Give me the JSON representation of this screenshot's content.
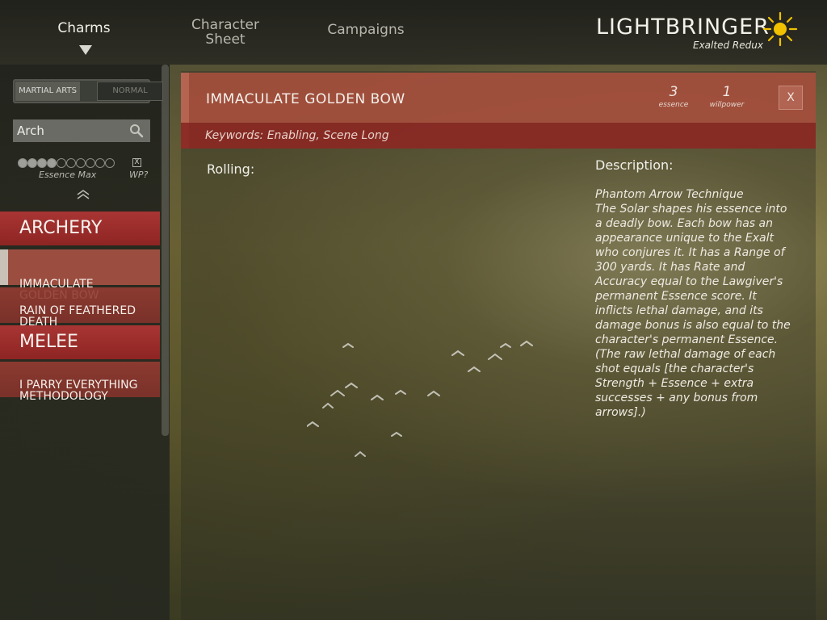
{
  "nav": {
    "tabs": [
      {
        "label": "Charms"
      },
      {
        "label": "Character\nSheet"
      },
      {
        "label": "Campaigns"
      }
    ],
    "active_tab": "Charms"
  },
  "brand": {
    "title": "LIGHTBRINGER",
    "subtitle": "Exalted Redux",
    "icon": "sun-icon",
    "accent": "#f2c200"
  },
  "sidebar": {
    "filter_toggle": {
      "options": [
        "MARTIAL ARTS",
        "NORMAL"
      ],
      "selected": "MARTIAL ARTS"
    },
    "search": {
      "value": "Arch",
      "placeholder": ""
    },
    "essence_max": {
      "label": "Essence Max",
      "filled": 4,
      "total": 10
    },
    "wp_filter": {
      "label": "WP?",
      "checked": true,
      "mark": "X"
    },
    "collapse_icon": "chevron-up-double-icon",
    "groups": [
      {
        "title": "ARCHERY",
        "charms": [
          {
            "name": "IMMACULATE\nGOLDEN BOW",
            "selected": true
          },
          {
            "name": "RAIN OF FEATHERED\nDEATH",
            "selected": false
          }
        ]
      },
      {
        "title": "MELEE",
        "charms": [
          {
            "name": "I PARRY EVERYTHING\nMETHODOLOGY",
            "selected": false
          }
        ]
      }
    ]
  },
  "detail": {
    "title": "IMMACULATE GOLDEN BOW",
    "essence": {
      "value": "3",
      "label": "essence"
    },
    "willpower": {
      "value": "1",
      "label": "willpower"
    },
    "close_label": "X",
    "keywords": "Keywords: Enabling, Scene Long",
    "rolling_label": "Rolling:",
    "description_label": "Description:",
    "description": "Phantom Arrow Technique\nThe Solar shapes his essence into\na deadly bow. Each bow has an\nappearance unique to the Exalt\nwho conjures it. It has a Range of\n300 yards. It has Rate and\nAccuracy equal to the Lawgiver's\npermanent Essence score. It\ninflicts lethal damage, and its\ndamage bonus is also equal to the\ncharacter's permanent Essence.\n(The raw lethal damage of each\nshot equals [the character's\nStrength + Essence + extra\nsuccesses + any bonus from\narrows].)"
  },
  "colors": {
    "category_red": "#a02e2c",
    "charm_red": "#8f3a30",
    "header_red": "#aa503e",
    "keywords_red": "#8c2824"
  }
}
